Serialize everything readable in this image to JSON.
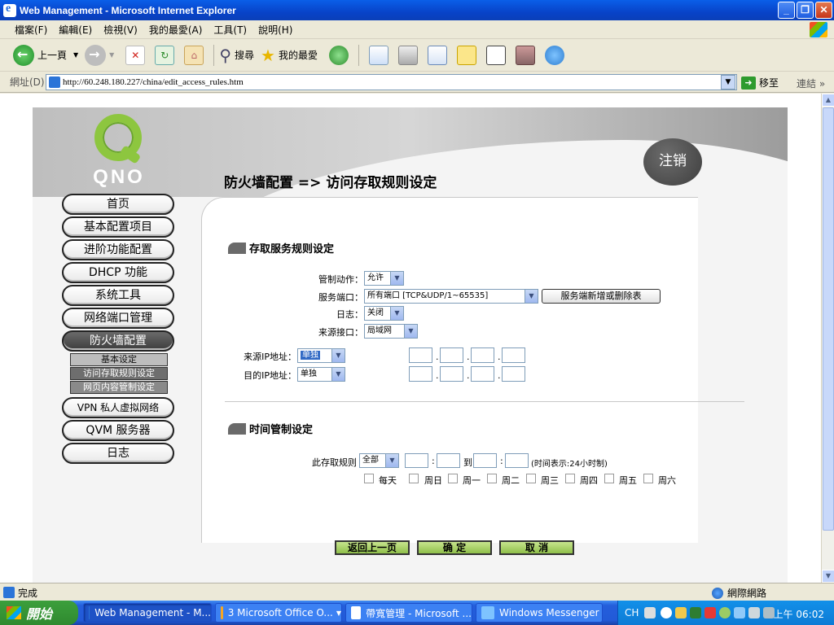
{
  "window": {
    "title": "Web Management - Microsoft Internet Explorer"
  },
  "menu": [
    "檔案(F)",
    "編輯(E)",
    "檢視(V)",
    "我的最愛(A)",
    "工具(T)",
    "說明(H)"
  ],
  "toolbar": {
    "back": "上一頁",
    "search": "搜尋",
    "favorites": "我的最愛"
  },
  "address": {
    "label": "網址(D)",
    "url": "http://60.248.180.227/china/edit_access_rules.htm",
    "go": "移至",
    "links": "連結"
  },
  "page": {
    "logo": "QNO",
    "logout": "注销",
    "title": "防火墙配置 => 访问存取规则设定",
    "nav": [
      {
        "label": "首页"
      },
      {
        "label": "基本配置项目"
      },
      {
        "label": "进阶功能配置"
      },
      {
        "label": "DHCP 功能"
      },
      {
        "label": "系统工具"
      },
      {
        "label": "网络端口管理"
      },
      {
        "label": "防火墙配置"
      },
      {
        "label": "VPN 私人虚拟网络"
      },
      {
        "label": "QVM 服务器"
      },
      {
        "label": "日志"
      }
    ],
    "subnav": [
      "基本设定",
      "访问存取规则设定",
      "网页内容管制设定"
    ],
    "section1": {
      "title": "存取服务规则设定",
      "action_label": "管制动作：",
      "action_value": "允许",
      "service_label": "服务端口：",
      "service_value": "所有端口 [TCP&UDP/1~65535]",
      "service_button": "服务端新增或删除表",
      "log_label": "日志：",
      "log_value": "关闭",
      "source_if_label": "来源接口：",
      "source_if_value": "局域网",
      "src_ip_label": "来源IP地址：",
      "src_ip_value": "单独",
      "dst_ip_label": "目的IP地址：",
      "dst_ip_value": "单独"
    },
    "section2": {
      "title": "时间管制设定",
      "rule_label": "此存取规则",
      "rule_value": "全部",
      "to": "到",
      "note": "(时间表示:24小时制)",
      "days": [
        "每天",
        "周日",
        "周一",
        "周二",
        "周三",
        "周四",
        "周五",
        "周六"
      ]
    },
    "buttons": {
      "back": "返回上一页",
      "ok": "确 定",
      "cancel": "取 消"
    }
  },
  "status": {
    "text": "完成",
    "zone": "網際網路"
  },
  "taskbar": {
    "start": "開始",
    "tasks": [
      "Web Management - M...",
      "3 Microsoft Office O...",
      "帶寬管理 - Microsoft ...",
      "Windows Messenger"
    ],
    "lang": "CH",
    "clock": "上午 06:02"
  }
}
